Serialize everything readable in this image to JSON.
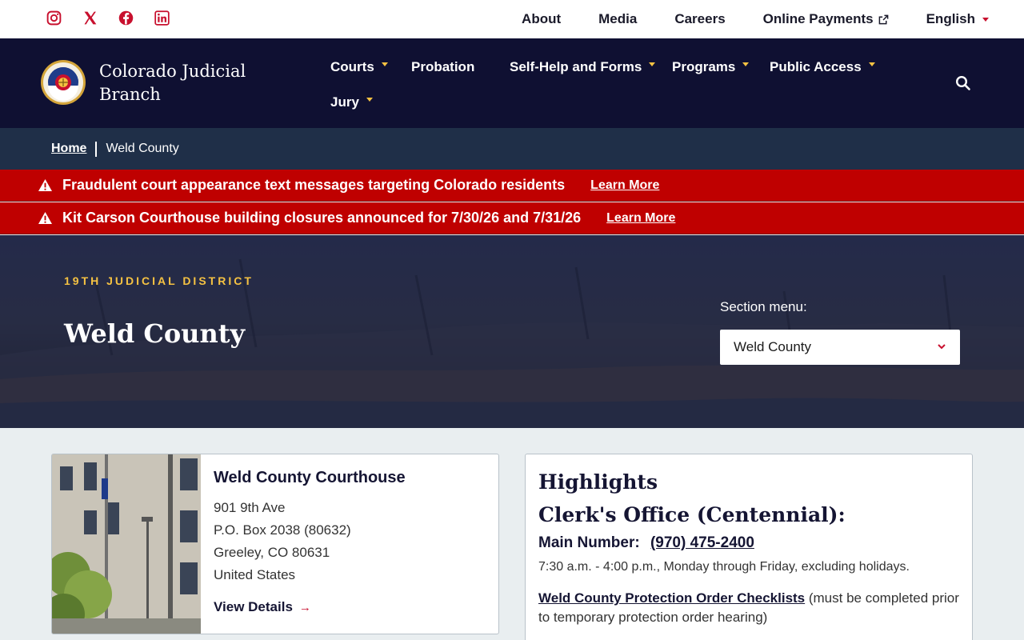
{
  "utility": {
    "social": [
      "instagram-icon",
      "x-icon",
      "facebook-icon",
      "linkedin-icon"
    ],
    "links": [
      {
        "label": "About"
      },
      {
        "label": "Media"
      },
      {
        "label": "Careers"
      },
      {
        "label": "Online Payments"
      }
    ],
    "language": "English"
  },
  "header": {
    "brand": "Colorado Judicial Branch",
    "nav": [
      {
        "label": "Courts",
        "has_menu": true
      },
      {
        "label": "Probation",
        "has_menu": false
      },
      {
        "label": "Self-Help and Forms",
        "has_menu": true
      },
      {
        "label": "Programs",
        "has_menu": true
      },
      {
        "label": "Public Access",
        "has_menu": true
      },
      {
        "label": "Jury",
        "has_menu": true
      }
    ]
  },
  "breadcrumb": {
    "home": "Home",
    "current": "Weld County"
  },
  "alerts": [
    {
      "text": "Fraudulent court appearance text messages targeting Colorado residents",
      "link": "Learn More"
    },
    {
      "text": "Kit Carson Courthouse building closures announced for 7/30/26 and 7/31/26",
      "link": "Learn More"
    }
  ],
  "hero": {
    "eyebrow": "19TH JUDICIAL DISTRICT",
    "title": "Weld County",
    "section_label": "Section menu:",
    "section_selected": "Weld County"
  },
  "courthouse": {
    "name": "Weld County Courthouse",
    "address": [
      "901 9th Ave",
      "P.O. Box 2038 (80632)",
      "Greeley, CO 80631",
      "United States"
    ],
    "view_details": "View Details"
  },
  "highlights": {
    "title": "Highlights",
    "clerk_title": "Clerk's Office (Centennial):",
    "main_number_label": "Main Number:",
    "main_number": "(970) 475-2400",
    "hours": "7:30 a.m. - 4:00 p.m., Monday through Friday, excluding holidays.",
    "checklist_link": "Weld County Protection Order Checklists",
    "checklist_note": " (must be completed prior to temporary protection order hearing)"
  },
  "colors": {
    "navy": "#0f1032",
    "breadcrumb_bg": "#1f2f48",
    "alert_red": "#bf0000",
    "gold_accent": "#f5c242",
    "brand_red": "#c8102e"
  }
}
